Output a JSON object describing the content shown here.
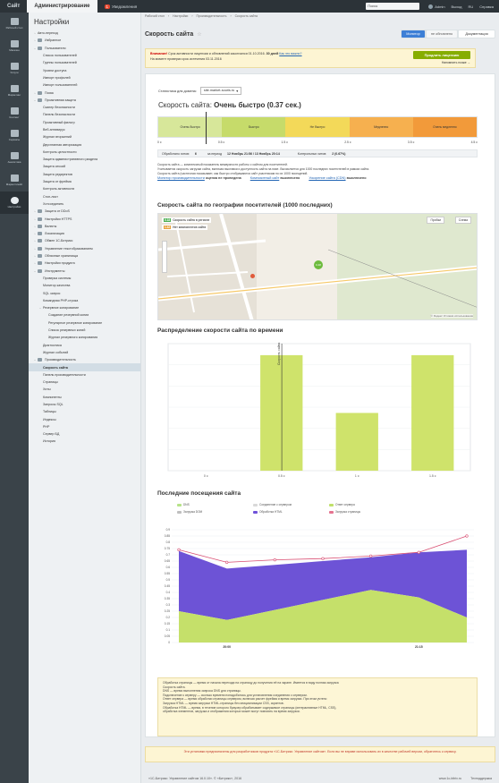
{
  "topbar": {
    "tabs": [
      "Сайт",
      "Администрирование"
    ],
    "count": "1",
    "notifications_label": "Уведомления",
    "search_placeholder": "Поиск",
    "user": "Admin",
    "right_items": [
      "Выход",
      "RU",
      "Справка"
    ]
  },
  "iconbar": {
    "items": [
      "Рабочий стол",
      "Магазин",
      "Услуги",
      "Маркетинг",
      "Контент",
      "Сервисы",
      "Аналитика",
      "Маркетплейс",
      "Настройки"
    ],
    "active_index": 8
  },
  "sidebar": {
    "title": "Настройки",
    "items": [
      {
        "label": "Авто-переход",
        "level": 0,
        "arrow": "›"
      },
      {
        "label": "Избранное",
        "level": 0,
        "arrow": "›",
        "icon": true
      },
      {
        "label": "Пользователи",
        "level": 0,
        "arrow": "⌄",
        "icon": true
      },
      {
        "label": "Список пользователей",
        "level": 1
      },
      {
        "label": "Группы пользователей",
        "level": 1
      },
      {
        "label": "Уровни доступа",
        "level": 1
      },
      {
        "label": "Импорт профилей",
        "level": 1
      },
      {
        "label": "Импорт пользователей",
        "level": 1
      },
      {
        "label": "Поиск",
        "level": 0,
        "arrow": "›",
        "icon": true
      },
      {
        "label": "Проактивная защита",
        "level": 0,
        "arrow": "⌄",
        "icon": true
      },
      {
        "label": "Сканер безопасности",
        "level": 1
      },
      {
        "label": "Панель безопасности",
        "level": 1
      },
      {
        "label": "Проактивный фильтр",
        "level": 1
      },
      {
        "label": "Веб-антивирус",
        "level": 1
      },
      {
        "label": "Журнал вторжений",
        "level": 1
      },
      {
        "label": "Двухэтапная авторизация",
        "level": 1
      },
      {
        "label": "Контроль целостности",
        "level": 1
      },
      {
        "label": "Защита административного раздела",
        "level": 1
      },
      {
        "label": "Защита сессий",
        "level": 1
      },
      {
        "label": "Защита редиректов",
        "level": 1
      },
      {
        "label": "Защита от фрейма",
        "level": 1
      },
      {
        "label": "Контроль активности",
        "level": 1
      },
      {
        "label": "Стоп-лист",
        "level": 1
      },
      {
        "label": "Хотсоединить",
        "level": 1
      },
      {
        "label": "Защита от DDoS",
        "level": 0,
        "arrow": "›",
        "icon": true
      },
      {
        "label": "Настройки HTTPS",
        "level": 0,
        "arrow": "›",
        "icon": true
      },
      {
        "label": "Валюты",
        "level": 0,
        "arrow": "›",
        "icon": true
      },
      {
        "label": "Локализация",
        "level": 0,
        "arrow": "›",
        "icon": true
      },
      {
        "label": "Обмен 1С-Битрикс",
        "level": 0,
        "arrow": "›",
        "icon": true
      },
      {
        "label": "Управление текстобразованием",
        "level": 0,
        "arrow": "›",
        "icon": true
      },
      {
        "label": "Облачные хранилища",
        "level": 0,
        "arrow": "›",
        "icon": true
      },
      {
        "label": "Настройки продукта",
        "level": 0,
        "arrow": "›",
        "icon": true
      },
      {
        "label": "Инструменты",
        "level": 0,
        "arrow": "⌄",
        "icon": true
      },
      {
        "label": "Проверка системы",
        "level": 1
      },
      {
        "label": "Монитор качества",
        "level": 1
      },
      {
        "label": "SQL запрос",
        "level": 1
      },
      {
        "label": "Командная PHP-строка",
        "level": 1
      },
      {
        "label": "Резервное копирование",
        "level": 1,
        "arrow": "⌄"
      },
      {
        "label": "Создание резервной копии",
        "level": 2
      },
      {
        "label": "Регулярное резервное копирование",
        "level": 2
      },
      {
        "label": "Список резервных копий",
        "level": 2
      },
      {
        "label": "Журнал резервного копирования",
        "level": 2
      },
      {
        "label": "Диагностика",
        "level": 1
      },
      {
        "label": "Журнал событий",
        "level": 1
      },
      {
        "label": "Производительность",
        "level": 0,
        "arrow": "⌄",
        "icon": true
      },
      {
        "label": "Скорость сайта",
        "level": 1,
        "active": true
      },
      {
        "label": "Панель производительности",
        "level": 1
      },
      {
        "label": "Страницы",
        "level": 1
      },
      {
        "label": "Хиты",
        "level": 1
      },
      {
        "label": "Компоненты",
        "level": 1
      },
      {
        "label": "Запросы SQL",
        "level": 1
      },
      {
        "label": "Таблицы",
        "level": 1
      },
      {
        "label": "Индексы",
        "level": 1
      },
      {
        "label": "PHP",
        "level": 1
      },
      {
        "label": "Сервер БД",
        "level": 1
      },
      {
        "label": "История",
        "level": 1
      }
    ]
  },
  "breadcrumbs": [
    "Рабочий стол",
    "Настройки",
    "Производительность",
    "Скорость сайта"
  ],
  "page": {
    "title": "Скорость сайта",
    "mode_buttons": [
      "Монитор",
      "не обновлено",
      "Документация"
    ],
    "warning_lead": "Внимание!",
    "warning_text": "Срок активности лицензии и обновлений закончился 01.10.2016.",
    "warning_text2": "30 дней",
    "warning_link": "Как это важно?",
    "warning_text3": "На момент проверки срок истечения 03.11.2016",
    "prolong_button": "Продлить лицензию",
    "prolong_link": "Напомнить позже →",
    "domain_label": "Статистика для домена:",
    "domain_value": "site.market-souris.ru",
    "speed_title_prefix": "Скорость сайта:",
    "speed_value": "Очень быстро (0.37 сек.)",
    "scale_labels": [
      "Очень быстро",
      "Быстро",
      "Не быстро",
      "Медленно",
      "Очень медленно"
    ],
    "scale_ticks": [
      "0 с",
      "0.5 с",
      "1.5 с",
      "2.5 с",
      "3.5 с",
      "4.5 с"
    ],
    "stats": {
      "visitors_label": "Обработано хитов:",
      "visitors_value": "6",
      "period_label": "за период",
      "period_value": "12 Ноябрь 21:56 / 13 Ноябрь 20:14",
      "control_label": "Контрольных хитов:",
      "control_value": "2 (0.67%)"
    },
    "description": [
      "Скорость сайта — комплексный показатель межвузности работы с сайтом для посетителей.",
      "Учитывается скорость загрузки сайта, включая выставки и доступность сайта на пике. Вычисляется для 1000 последних посетителей в рамках сайта.",
      "Скорость сайта (частичная показывает, как быстро отображаются сайт участникам по их 1000 посещений."
    ],
    "monitor_items": [
      {
        "label": "Монитор производительности",
        "state": "оценка не проведена"
      },
      {
        "label": "Композитный сайт",
        "state": "выключено"
      },
      {
        "label": "Ускорение сайта (CDN)",
        "state": "выключено"
      }
    ],
    "geo_title": "Скорость сайта по географии посетителей (1000 последних)",
    "map_legend": [
      {
        "value": "0.18",
        "label": "Скорость сайта в регионе",
        "color": "#4caf50"
      },
      {
        "value": "1.42",
        "label": "Нет компонентов сайта",
        "color": "#e8a33d"
      }
    ],
    "map_controls": [
      "Пробки",
      "Схема"
    ],
    "map_point": "0.48",
    "map_credits": "© Яндекс  Условия использования",
    "dist_title": "Распределение скорости сайта по времени",
    "visits_title": "Последние посещения сайта",
    "visits_legend": [
      {
        "label": "DNS",
        "color": "#b6e388"
      },
      {
        "label": "Соединение с сервером",
        "color": "#d9d9d9"
      },
      {
        "label": "Ответ сервера",
        "color": "#c0e06a"
      },
      {
        "label": "Загрузка DOM",
        "color": "#bfbfbf"
      },
      {
        "label": "Обработка HTML",
        "color": "#6f52d9"
      },
      {
        "label": "Загрузка страницы",
        "color": "#e57390"
      }
    ],
    "footnote": [
      "Обработка страницы — время от начала перехода на страницу до получения её на экране. Имеется в виду полная загрузка",
      "Скорость сайта.",
      "DNS — время выполнения запроса DNS для страницы.",
      "Подключение к серверу — сколько времени понадобилось для установления соединения с сервером.",
      "Ответ сервера — время обработки страницы сервером, включая расчет фрейма и время загрузки. При этом учтено",
      "Загрузка HTML — время загрузки HTML-страницы без инициализации CSS, скриптов.",
      "Обработка HTML — время, в течение которого браузер обрабатывает содержимое страницы (интерактивные HTML, CSS),",
      "обработка элементов, загрузка и отображения которых может могут повлиять на время загрузки."
    ],
    "bottom_warning": "Эти установки предназначены для разработчиков продукта «1С-Битрикс: Управление сайтом». Если вы не вправе использовать их в качестве рабочей версии, обратитесь к сервису.",
    "footer_left": "«1С-Битрикс: Управление сайтом 16.0.10». © «Битрикс», 2016",
    "footer_right": [
      "www.1c-bitrix.ru",
      "Техподдержка"
    ]
  },
  "chart_data": [
    {
      "type": "bar",
      "categories": [
        "0 с",
        "0.5 с",
        "1 с",
        "1.5 с"
      ],
      "values": [
        0,
        2,
        1,
        2
      ],
      "ylim": [
        0,
        2.2
      ],
      "annotation": "Скорость сайта",
      "annotation_x": 0.37
    },
    {
      "type": "area",
      "x": [
        "",
        "20:00",
        "",
        "",
        "",
        "21:15",
        ""
      ],
      "series": [
        {
          "name": "Ответ сервера",
          "values": [
            0.25,
            0.18,
            0.26,
            0.34,
            0.42,
            0.36,
            0.2
          ]
        },
        {
          "name": "Обработка HTML",
          "values": [
            0.73,
            0.59,
            0.62,
            0.65,
            0.68,
            0.72,
            0.74
          ]
        },
        {
          "name": "Загрузка страницы",
          "values": [
            0.74,
            0.64,
            0.66,
            0.67,
            0.69,
            0.72,
            0.85
          ]
        }
      ],
      "ylim": [
        0,
        0.9
      ],
      "yticks": [
        "0",
        "0.05",
        "0.1",
        "0.15",
        "0.2",
        "0.25",
        "0.3",
        "0.35",
        "0.4",
        "0.45",
        "0.5",
        "0.55",
        "0.6",
        "0.65",
        "0.7",
        "0.75",
        "0.8",
        "0.85",
        "0.9"
      ]
    }
  ]
}
